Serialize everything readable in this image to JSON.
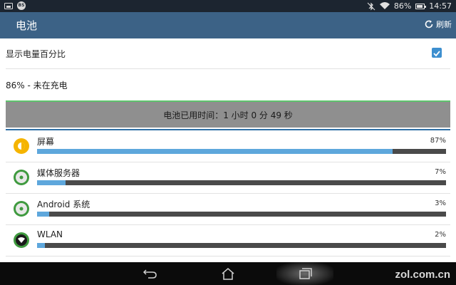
{
  "status_bar": {
    "left_icons": [
      "image-icon",
      "bs-icon"
    ],
    "right_icons": [
      "bluetooth-muted-icon",
      "wifi-icon",
      "battery-icon"
    ],
    "battery": "86%",
    "time": "14:57"
  },
  "action_bar": {
    "title": "电池",
    "refresh_label": "刷新",
    "refresh_icon": "refresh-icon",
    "color": "#3c6286"
  },
  "settings": {
    "show_percent_label": "显示电量百分比",
    "show_percent_checked": true,
    "battery_status": "86% - 未在充电"
  },
  "graph": {
    "text": "电池已用时间：1 小时 0 分 49 秒"
  },
  "usage": [
    {
      "name": "屏幕",
      "percent": "87%",
      "fraction": 0.87,
      "icon": "screen-brightness-icon"
    },
    {
      "name": "媒体服务器",
      "percent": "7%",
      "fraction": 0.07,
      "icon": "media-server-icon"
    },
    {
      "name": "Android 系统",
      "percent": "3%",
      "fraction": 0.03,
      "icon": "android-system-icon"
    },
    {
      "name": "WLAN",
      "percent": "2%",
      "fraction": 0.02,
      "icon": "wlan-icon"
    }
  ],
  "nav": {
    "icons": [
      "back-icon",
      "home-icon",
      "recent-apps-icon"
    ]
  },
  "watermark": "zol.com.cn",
  "colors": {
    "bar_fill": "#5ea7dc",
    "bar_track": "#4a4a4a",
    "checkbox": "#3d8fcf"
  }
}
